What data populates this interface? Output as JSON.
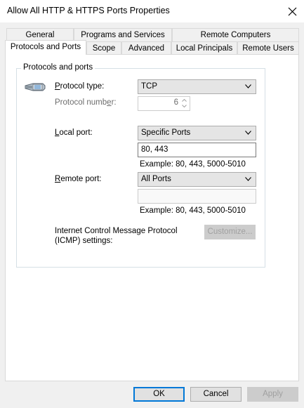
{
  "window": {
    "title": "Allow All HTTP & HTTPS Ports Properties",
    "close_icon": "close-icon"
  },
  "tabs": {
    "row1": [
      "General",
      "Programs and Services",
      "Remote Computers"
    ],
    "row2": [
      "Protocols and Ports",
      "Scope",
      "Advanced",
      "Local Principals",
      "Remote Users"
    ],
    "active": "Protocols and Ports"
  },
  "group": {
    "legend": "Protocols and ports",
    "protocol_icon": "network-cable-icon",
    "protocol_type_label": "Protocol type:",
    "protocol_type_value": "TCP",
    "protocol_number_label": "Protocol number:",
    "protocol_number_value": "6",
    "local_port_label": "Local port:",
    "local_port_select": "Specific Ports",
    "local_port_value": "80, 443",
    "local_port_example": "Example: 80, 443, 5000-5010",
    "remote_port_label": "Remote port:",
    "remote_port_select": "All Ports",
    "remote_port_value": "",
    "remote_port_example": "Example: 80, 443, 5000-5010",
    "icmp_label_line1": "Internet Control Message Protocol",
    "icmp_label_line2": "(ICMP) settings:",
    "customize_label": "Customize..."
  },
  "footer": {
    "ok_label": "OK",
    "cancel_label": "Cancel",
    "apply_label": "Apply"
  },
  "colors": {
    "accent": "#0078d7",
    "panel": "#ffffff",
    "dialog": "#f0f0f0"
  }
}
